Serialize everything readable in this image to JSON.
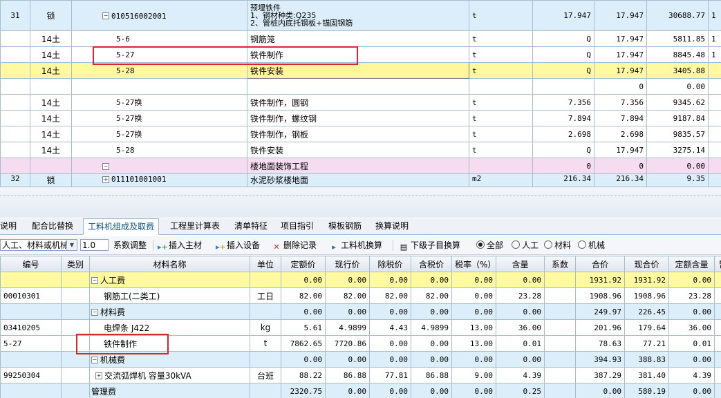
{
  "top_grid": {
    "rows": [
      {
        "style": "light",
        "kind": "tall",
        "no": "31",
        "cat": "锁",
        "code": "010516002001",
        "toggle": "−",
        "name_lines": [
          "预埋铁件",
          "1、钢材种类:Q235",
          "2、管桩内底托钢板+锚固钢筋"
        ],
        "unit": "t",
        "qty_expr": "17.947",
        "qty": "17.947",
        "price": "30688.77",
        "extra": "1"
      },
      {
        "style": "white",
        "no": "",
        "cat": "14土",
        "code": "5-6",
        "name": "钢筋笼",
        "unit": "t",
        "qty_expr": "Q",
        "qty": "17.947",
        "price": "5811.85",
        "extra": "1"
      },
      {
        "style": "white",
        "no": "",
        "cat": "14土",
        "code": "5-27",
        "name": "铁件制作",
        "unit": "t",
        "qty_expr": "Q",
        "qty": "17.947",
        "price": "8845.48",
        "extra": "1"
      },
      {
        "style": "yellow",
        "no": "",
        "cat": "14土",
        "code": "5-28",
        "name": "铁件安装",
        "unit": "t",
        "qty_expr": "Q",
        "qty": "17.947",
        "price": "3405.88",
        "extra": ""
      },
      {
        "style": "white",
        "no": "",
        "cat": "",
        "code": "",
        "name": "",
        "unit": "",
        "qty_expr": "",
        "qty": "0",
        "price": "0.00",
        "extra": ""
      },
      {
        "style": "white",
        "no": "",
        "cat": "14土",
        "code": "5-27换",
        "name": "铁件制作，圆钢",
        "unit": "t",
        "qty_expr": "7.356",
        "qty": "7.356",
        "price": "9345.62",
        "extra": ""
      },
      {
        "style": "white",
        "no": "",
        "cat": "14土",
        "code": "5-27换",
        "name": "铁件制作，螺纹钢",
        "unit": "t",
        "qty_expr": "7.894",
        "qty": "7.894",
        "price": "9187.84",
        "extra": ""
      },
      {
        "style": "white",
        "no": "",
        "cat": "14土",
        "code": "5-27换",
        "name": "铁件制作，钢板",
        "unit": "t",
        "qty_expr": "2.698",
        "qty": "2.698",
        "price": "9835.57",
        "extra": ""
      },
      {
        "style": "white",
        "no": "",
        "cat": "14土",
        "code": "5-28",
        "name": "铁件安装",
        "unit": "t",
        "qty_expr": "Q",
        "qty": "17.947",
        "price": "3275.14",
        "extra": ""
      },
      {
        "style": "pink",
        "no": "",
        "cat": "",
        "code": "",
        "toggle": "−",
        "name": "楼地面装饰工程",
        "unit": "",
        "qty_expr": "0",
        "qty": "0",
        "price": "0.00",
        "extra": ""
      },
      {
        "style": "light",
        "kind": "partial",
        "no": "32",
        "cat": "锁",
        "code": "011101001001",
        "toggle": "+",
        "name": "水泥砂浆楼地面",
        "unit": "m2",
        "qty_expr": "216.34",
        "qty": "216.34",
        "price": "9.35",
        "extra": ""
      }
    ]
  },
  "tabs": [
    "说明",
    "配合比替换",
    "工料机组成及取费",
    "工程里计算表",
    "清单特征",
    "项目指引",
    "模板钢筋",
    "换算说明"
  ],
  "active_tab": "工料机组成及取费",
  "toolbar": {
    "filter_value": "人工、材料或机械",
    "factor_value": "1.0",
    "factor_label": "系数调整",
    "insert_main": "插入主材",
    "insert_equipment": "插入设备",
    "delete_record": "删除记录",
    "machine_convert": "工料机换算",
    "sub_convert": "下级子目换算",
    "radio_all": "全部",
    "radio_labor": "人工",
    "radio_material": "材料",
    "radio_machine": "机械"
  },
  "bottom_grid": {
    "headers": [
      "编号",
      "类别",
      "材料名称",
      "单位",
      "定额价",
      "现行价",
      "除税价",
      "含税价",
      "税率（%）",
      "含量",
      "系数",
      "合价",
      "现合价",
      "定额含量",
      "暂"
    ],
    "rows": [
      {
        "style": "yellow",
        "code": "",
        "type": "",
        "toggle": "−",
        "name": "人工费",
        "level": 1,
        "unit": "",
        "v": [
          "0.00",
          "0.00",
          "0.00",
          "0.00",
          "0.00",
          "0.00",
          "",
          "1931.92",
          "1931.92",
          "0.00"
        ]
      },
      {
        "style": "white",
        "code": "00010301",
        "type": "",
        "name": "钢筋工(二类工)",
        "level": 2,
        "unit": "工日",
        "v": [
          "82.00",
          "82.00",
          "82.00",
          "82.00",
          "0.00",
          "23.28",
          "",
          "1908.96",
          "1908.96",
          "23.28"
        ]
      },
      {
        "style": "light",
        "code": "",
        "type": "",
        "toggle": "−",
        "name": "材料费",
        "level": 1,
        "unit": "",
        "v": [
          "0.00",
          "0.00",
          "0.00",
          "0.00",
          "0.00",
          "0.00",
          "",
          "249.97",
          "226.45",
          "0.00"
        ]
      },
      {
        "style": "white",
        "code": "03410205",
        "type": "",
        "name": "电焊条 J422",
        "level": 2,
        "unit": "kg",
        "v": [
          "5.61",
          "4.9899",
          "4.43",
          "4.9899",
          "13.00",
          "36.00",
          "",
          "201.96",
          "179.64",
          "36.00"
        ]
      },
      {
        "style": "white",
        "code": "5-27",
        "type": "",
        "name": "铁件制作",
        "level": 2,
        "unit": "t",
        "v": [
          "7862.65",
          "7720.86",
          "0.00",
          "0.00",
          "13.00",
          "0.01",
          "",
          "78.63",
          "77.21",
          "0.01"
        ]
      },
      {
        "style": "light",
        "code": "",
        "type": "",
        "toggle": "−",
        "name": "机械费",
        "level": 1,
        "unit": "",
        "v": [
          "0.00",
          "0.00",
          "0.00",
          "0.00",
          "0.00",
          "0.00",
          "",
          "394.93",
          "388.83",
          "0.00"
        ]
      },
      {
        "style": "white",
        "code": "99250304",
        "type": "",
        "toggle": "+",
        "name": "交流弧焊机 容量30kVA",
        "level": 2,
        "unit": "台班",
        "v": [
          "88.22",
          "86.88",
          "77.81",
          "86.88",
          "9.00",
          "4.39",
          "",
          "387.29",
          "381.40",
          "4.39"
        ]
      },
      {
        "style": "light",
        "code": "",
        "type": "",
        "name": "管理费",
        "level": 1,
        "unit": "",
        "v": [
          "2320.75",
          "0.00",
          "0.00",
          "0.00",
          "0.00",
          "0.25",
          "",
          "0.00",
          "580.19",
          "0.00"
        ]
      }
    ]
  }
}
